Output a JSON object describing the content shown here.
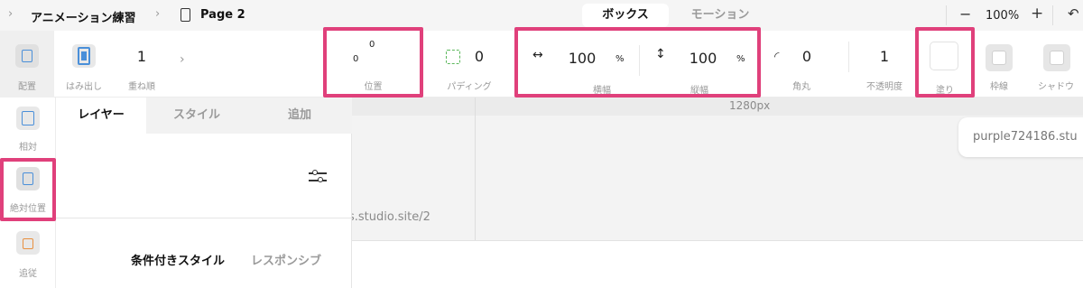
{
  "breadcrumb": {
    "project": "アニメーション練習",
    "page": "Page 2"
  },
  "mode_tabs": [
    {
      "label": "ボックス",
      "active": true
    },
    {
      "label": "モーション",
      "active": false
    }
  ],
  "zoom": {
    "minus": "−",
    "value": "100%",
    "plus": "+"
  },
  "toolbar": {
    "placement": {
      "label": "配置"
    },
    "overflow": {
      "label": "はみ出し"
    },
    "order": {
      "label": "重ね順",
      "value": "1"
    },
    "position": {
      "label": "位置",
      "top": "0",
      "left": "0"
    },
    "padding": {
      "label": "パディング",
      "value": "0"
    },
    "width": {
      "label": "横幅",
      "value": "100",
      "unit": "%"
    },
    "height": {
      "label": "縦幅",
      "value": "100",
      "unit": "%"
    },
    "radius": {
      "label": "角丸",
      "value": "0"
    },
    "opacity": {
      "label": "不透明度",
      "value": "1"
    },
    "fill": {
      "label": "塗り"
    },
    "border": {
      "label": "枠線"
    },
    "shadow": {
      "label": "シャドウ"
    }
  },
  "position_modes": [
    {
      "label": "相対"
    },
    {
      "label": "絶対位置"
    },
    {
      "label": "追従"
    }
  ],
  "panel": {
    "tabs": [
      "レイヤー",
      "スタイル",
      "追加"
    ],
    "conditional_style": "条件付きスタイル",
    "responsive": "レスポンシブ"
  },
  "canvas": {
    "ruler_label": "1280px",
    "site_url_fragment": "s.studio.site/2",
    "site_chip": "purple724186.stu"
  },
  "colors": {
    "highlight": "#e0407b",
    "accent_blue": "#4a8fd9",
    "accent_orange": "#e89040",
    "accent_green": "#5cb85c"
  }
}
